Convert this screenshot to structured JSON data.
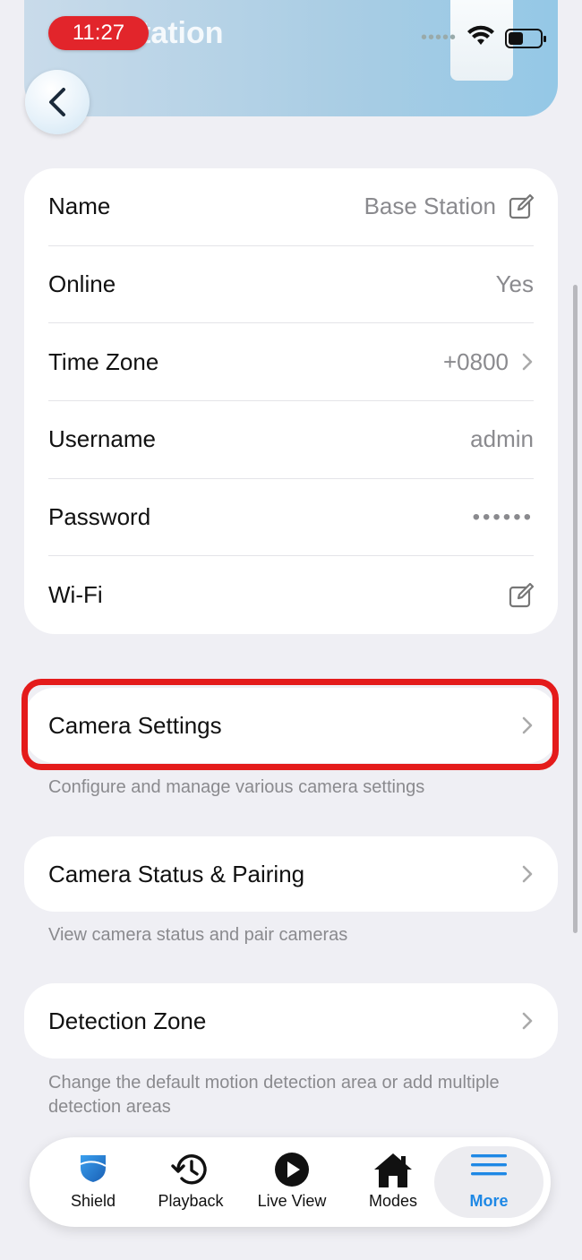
{
  "status_bar": {
    "time": "11:27",
    "dots": "•••••"
  },
  "header": {
    "title": "tation"
  },
  "info": {
    "rows": [
      {
        "label": "Name",
        "value": "Base Station"
      },
      {
        "label": "Online",
        "value": "Yes"
      },
      {
        "label": "Time Zone",
        "value": "+0800"
      },
      {
        "label": "Username",
        "value": "admin"
      },
      {
        "label": "Password",
        "value": "••••••"
      },
      {
        "label": "Wi-Fi",
        "value": ""
      }
    ]
  },
  "sections": [
    {
      "label": "Camera Settings",
      "description": "Configure and manage various camera settings"
    },
    {
      "label": "Camera Status & Pairing",
      "description": "View camera status and pair cameras"
    },
    {
      "label": "Detection Zone",
      "description": "Change the default motion detection area or add multiple detection areas"
    }
  ],
  "tabbar": {
    "tabs": [
      {
        "label": "Shield"
      },
      {
        "label": "Playback"
      },
      {
        "label": "Live View"
      },
      {
        "label": "Modes"
      },
      {
        "label": "More"
      }
    ]
  },
  "colors": {
    "accent": "#1e88e5",
    "highlight": "#e41b1b",
    "time_pill": "#e2252b"
  }
}
